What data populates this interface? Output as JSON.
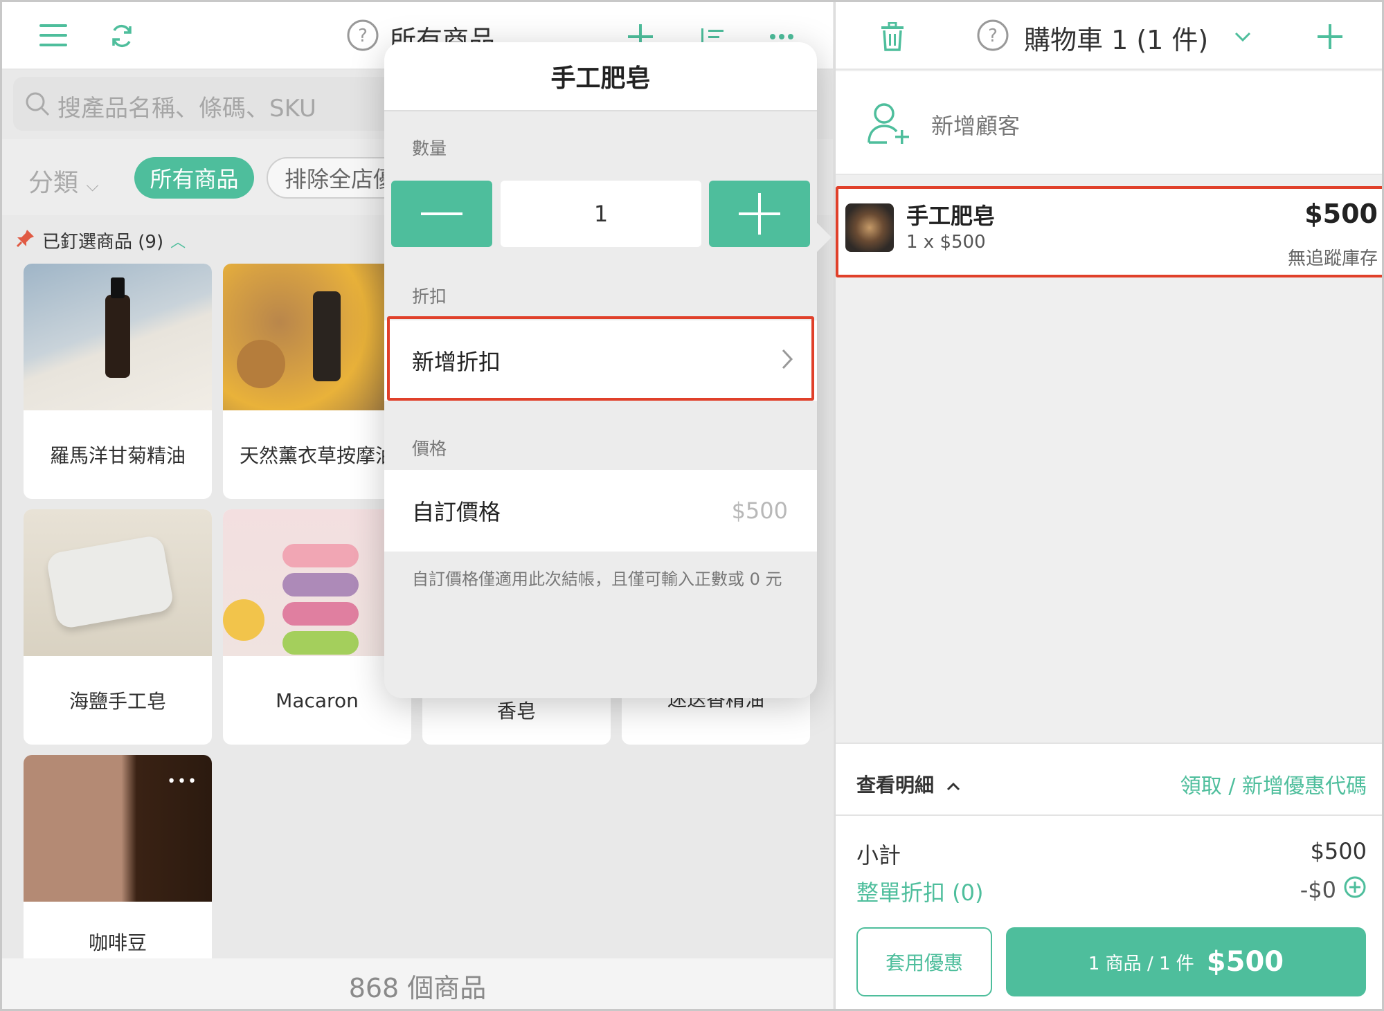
{
  "colors": {
    "accent": "#4ebe9c",
    "highlight": "#e0402a"
  },
  "left": {
    "title": "所有商品",
    "search_placeholder": "搜產品名稱、條碼、SKU",
    "category_label": "分類",
    "chips": [
      "所有商品",
      "排除全店優"
    ],
    "pinned_label": "已釘選商品 (9)",
    "products": [
      {
        "name": "羅馬洋甘菊精油"
      },
      {
        "name": "天然薰衣草按摩油"
      },
      {
        "name": "海鹽手工皂"
      },
      {
        "name": "Macaron"
      },
      {
        "name": "香皂"
      },
      {
        "name": "迷迭香精油"
      },
      {
        "name": "咖啡豆"
      }
    ],
    "count_text": "868 個商品"
  },
  "popover": {
    "title": "手工肥皂",
    "qty_label": "數量",
    "qty_value": "1",
    "discount_label": "折扣",
    "add_discount": "新增折扣",
    "price_label": "價格",
    "custom_price": "自訂價格",
    "custom_price_placeholder": "$500",
    "note": "自訂價格僅適用此次結帳，且僅可輸入正數或 0 元"
  },
  "cart": {
    "title": "購物車 1 (1 件)",
    "add_customer": "新增顧客",
    "item": {
      "name": "手工肥皂",
      "qty_line": "1 x $500",
      "price": "$500",
      "stock": "無追蹤庫存"
    },
    "details_label": "查看明細",
    "coupon_link": "領取 / 新增優惠代碼",
    "subtotal_label": "小計",
    "subtotal_value": "$500",
    "order_discount_label": "整單折扣 (0)",
    "order_discount_value": "-$0",
    "apply_offer": "套用優惠",
    "checkout_items": "1 商品 / 1 件",
    "checkout_total": "$500"
  }
}
